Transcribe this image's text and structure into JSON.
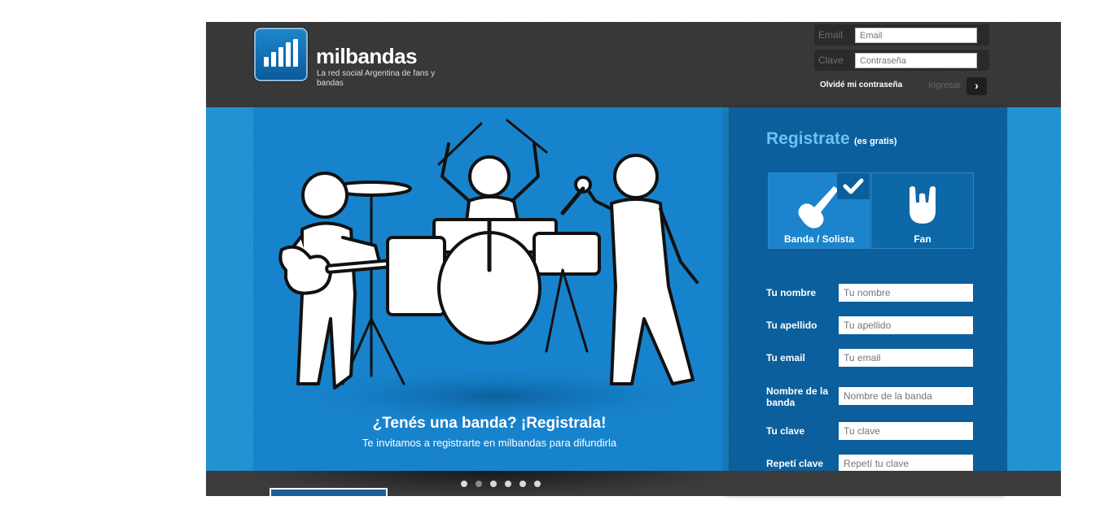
{
  "header": {
    "logo_text": "milbandas",
    "tagline": "La red social Argentina de fans y bandas",
    "login": {
      "email_label": "Email",
      "email_placeholder": "Email",
      "password_label": "Clave",
      "password_placeholder": "Contraseña",
      "forgot_link": "Olvidé mi contraseña",
      "submit_label": "Ingresar",
      "submit_icon": "chevron-right-icon"
    }
  },
  "hero": {
    "title": "¿Tenés una banda? ¡Registrala!",
    "subtitle": "Te invitamos a registrarte en milbandas para difundirla"
  },
  "register": {
    "title": "Registrate",
    "free_note": "(es gratis)",
    "types": [
      {
        "label": "Banda / Solista",
        "icon": "guitar-icon",
        "selected": true
      },
      {
        "label": "Fan",
        "icon": "rock-hand-icon",
        "selected": false
      }
    ],
    "fields": [
      {
        "label": "Tu nombre",
        "placeholder": "Tu nombre"
      },
      {
        "label": "Tu apellido",
        "placeholder": "Tu apellido"
      },
      {
        "label": "Tu email",
        "placeholder": "Tu email"
      },
      {
        "label": "Nombre de la banda",
        "placeholder": "Nombre de la banda"
      },
      {
        "label": "Tu clave",
        "placeholder": "Tu clave"
      },
      {
        "label": "Repetí clave",
        "placeholder": "Repetí tu clave"
      }
    ]
  },
  "carousel": {
    "dot_count": 6,
    "active_index": 1
  },
  "colors": {
    "header_bg": "#3b3b3b",
    "main_bg": "#2596d4",
    "hero_bg": "#1783cc",
    "register_bg": "#0b5f9c",
    "accent": "#69c3f5"
  }
}
